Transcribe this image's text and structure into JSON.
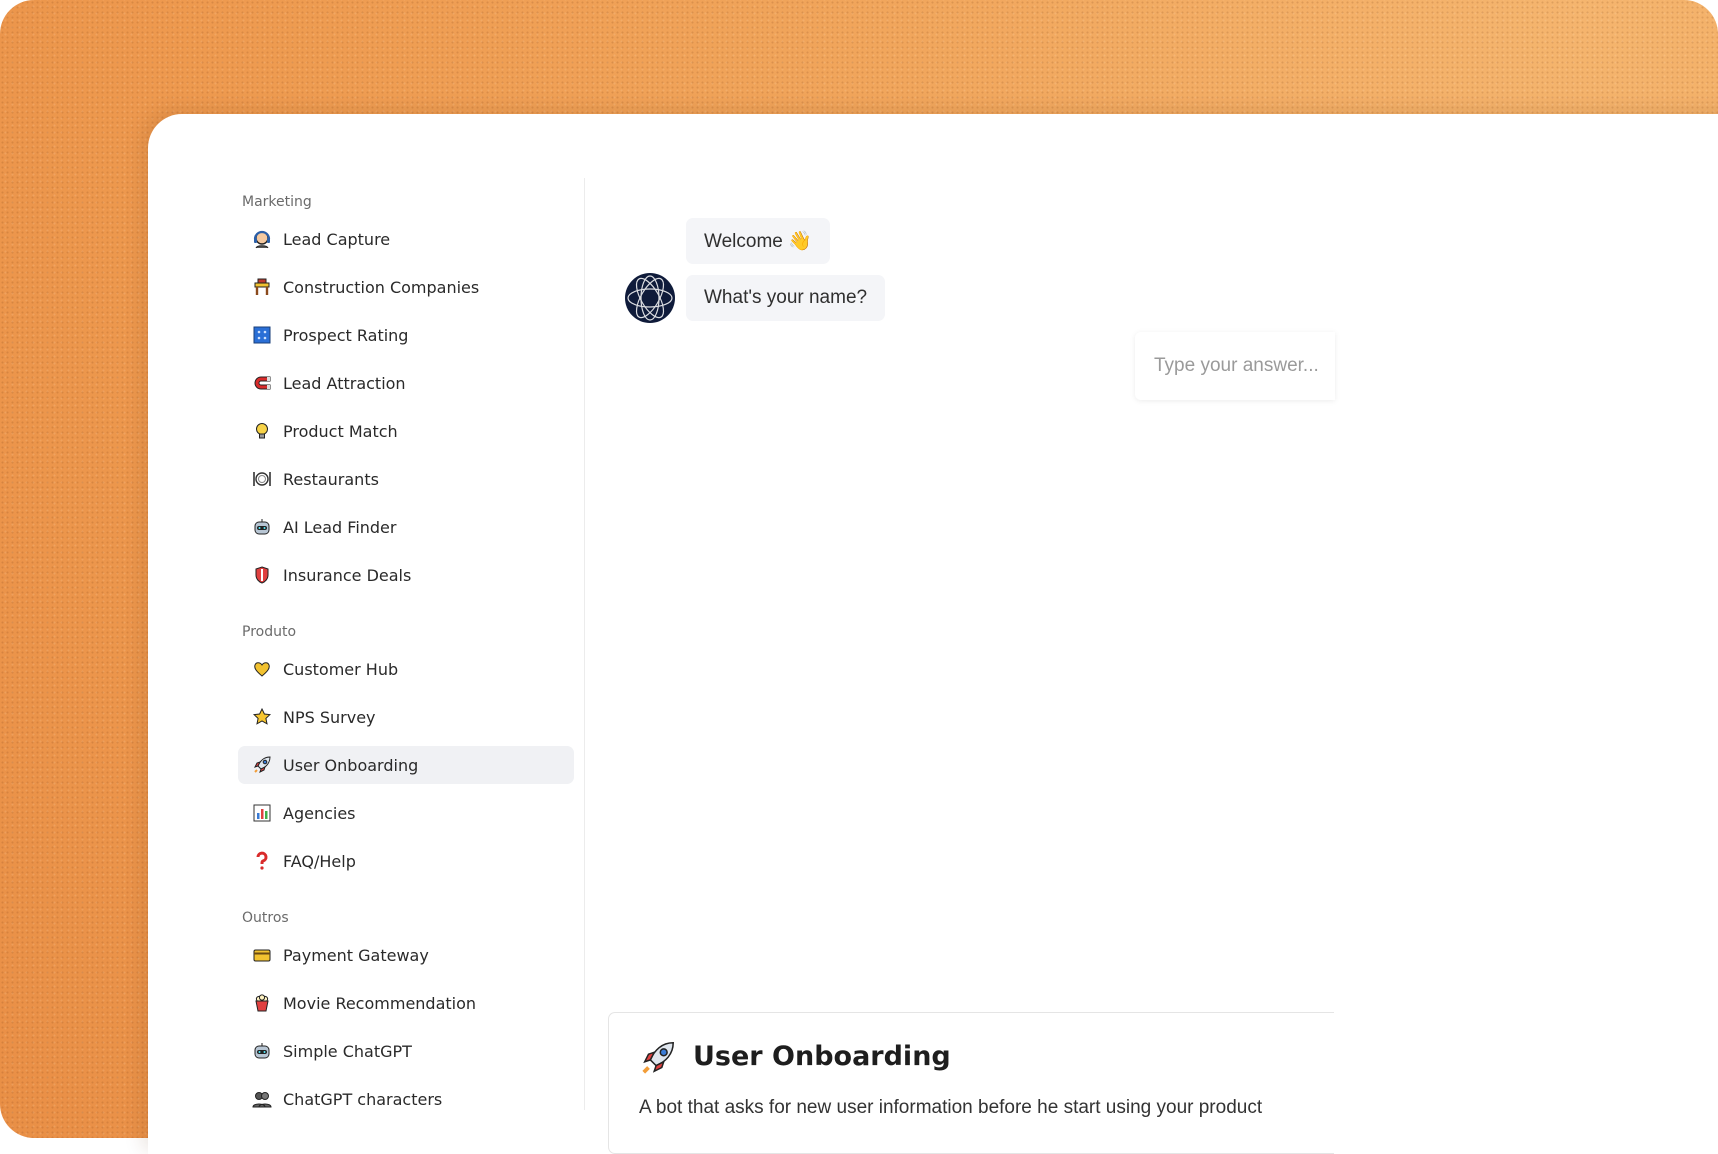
{
  "sidebar": {
    "sections": [
      {
        "title": "Marketing"
      },
      {
        "title": "Produto"
      },
      {
        "title": "Outros"
      }
    ],
    "items": [
      {
        "label": "Lead Capture",
        "icon": "headset-icon"
      },
      {
        "label": "Construction Companies",
        "icon": "construction-icon"
      },
      {
        "label": "Prospect Rating",
        "icon": "abacus-icon"
      },
      {
        "label": "Lead Attraction",
        "icon": "magnet-icon"
      },
      {
        "label": "Product Match",
        "icon": "lightbulb-icon"
      },
      {
        "label": "Restaurants",
        "icon": "plate-icon"
      },
      {
        "label": "AI Lead Finder",
        "icon": "robot-icon"
      },
      {
        "label": "Insurance Deals",
        "icon": "shield-icon"
      },
      {
        "label": "Customer Hub",
        "icon": "heart-hands-icon"
      },
      {
        "label": "NPS Survey",
        "icon": "star-icon"
      },
      {
        "label": "User Onboarding",
        "icon": "rocket-icon",
        "active": true
      },
      {
        "label": "Agencies",
        "icon": "bar-chart-icon"
      },
      {
        "label": "FAQ/Help",
        "icon": "question-icon"
      },
      {
        "label": "Payment Gateway",
        "icon": "credit-card-icon"
      },
      {
        "label": "Movie Recommendation",
        "icon": "popcorn-icon"
      },
      {
        "label": "Simple ChatGPT",
        "icon": "robot-icon"
      },
      {
        "label": "ChatGPT characters",
        "icon": "people-icon"
      }
    ]
  },
  "chat": {
    "messages": [
      "Welcome 👋",
      "What's your name?"
    ],
    "input_placeholder": "Type your answer..."
  },
  "info": {
    "title": "User Onboarding",
    "description": "A bot that asks for new user information before he start using your product"
  },
  "colors": {
    "background": "#ef9d52",
    "active_item": "#f0f1f4",
    "bubble": "#f4f5f8"
  }
}
